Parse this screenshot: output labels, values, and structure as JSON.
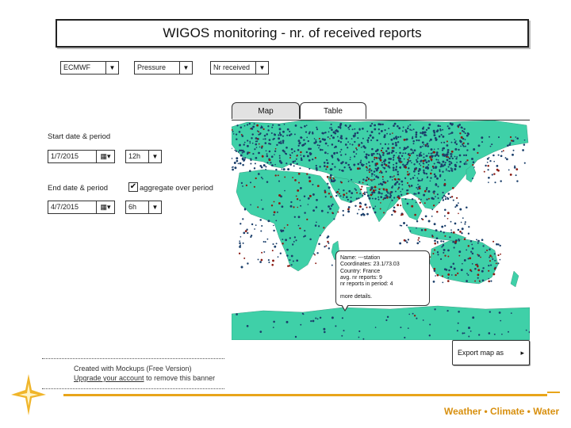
{
  "header": {
    "title": "WIGOS monitoring - nr. of received reports"
  },
  "filters": {
    "center": "ECMWF",
    "variable": "Pressure",
    "metric": "Nr received"
  },
  "start": {
    "label": "Start date & period",
    "date": "1/7/2015",
    "period": "12h"
  },
  "end": {
    "label": "End date & period",
    "date": "4/7/2015",
    "period": "6h",
    "aggregate_label": "aggregate over period",
    "aggregate_checked": true
  },
  "tabs": [
    {
      "label": "Map",
      "active": true
    },
    {
      "label": "Table",
      "active": false
    }
  ],
  "popup": {
    "lines": [
      "Name: ---station",
      "Coordinates: 23.1/73.03",
      "Country: France",
      "avg. nr reports: 9",
      "nr reports in period: 4",
      "",
      "more details."
    ]
  },
  "export": {
    "label": "Export map as",
    "arrow": "▸"
  },
  "banner": {
    "line1": "Created with Mockups (Free Version)",
    "link": "Upgrade your account",
    "line2_rest": " to remove this banner"
  },
  "footer": {
    "tagline": "Weather • Climate • Water"
  },
  "colors": {
    "ocean": "#ffffff",
    "land": "#3fd0a8",
    "station_blue": "#1b3f6b",
    "station_red": "#8a1a12",
    "accent_orange": "#e8a51a"
  },
  "icons": [
    "calendar-icon",
    "dropdown-arrow-icon",
    "checkbox-icon",
    "wmo-star-logo"
  ]
}
